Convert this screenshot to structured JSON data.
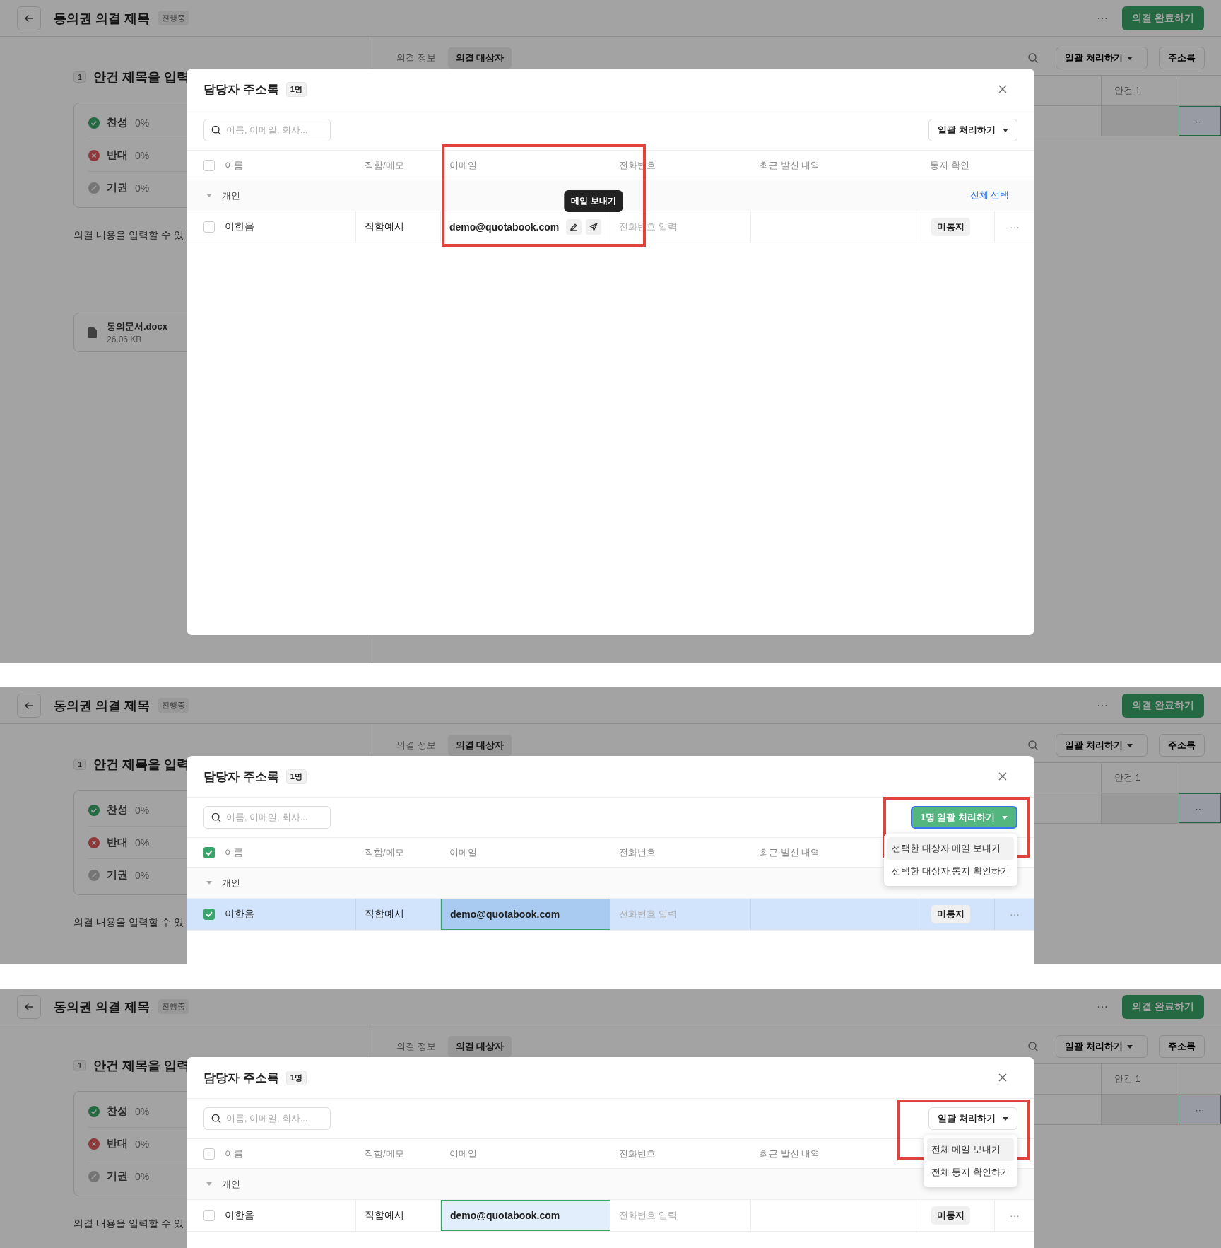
{
  "panels": [
    {
      "app": {
        "title": "동의권 의결 제목",
        "status_badge": "진행중",
        "more": "···",
        "complete_button": "의결 완료하기",
        "agenda": {
          "number": "1",
          "title": "안건 제목을 입력"
        },
        "votes": [
          {
            "kind": "for",
            "label": "찬성",
            "percent": "0%"
          },
          {
            "kind": "against",
            "label": "반대",
            "percent": "0%"
          },
          {
            "kind": "abstain",
            "label": "기권",
            "percent": "0%"
          }
        ],
        "description": "의결 내용을 입력할 수 있",
        "attachment": {
          "name": "동의문서.docx",
          "size": "26.06 KB"
        },
        "tabs": [
          {
            "label": "의결 정보",
            "selected": false
          },
          {
            "label": "의결 대상자",
            "selected": true
          }
        ],
        "batch_button": "일괄 처리하기",
        "address_book_button": "주소록",
        "sheet": {
          "column": "안건 1",
          "cell": "···"
        }
      },
      "modal": {
        "title": "담당자 주소록",
        "count": "1명",
        "search": {
          "placeholder": "이름, 이메일, 회사..."
        },
        "batch_button": {
          "label": "일괄 처리하기",
          "primary": false
        },
        "columns": [
          "이름",
          "직함/메모",
          "이메일",
          "전화번호",
          "최근 발신 내역",
          "통지 확인"
        ],
        "all_checked": false,
        "groups": [
          {
            "label": "개인",
            "expanded": true,
            "select_all": "전체 선택",
            "rows": [
              {
                "checked": false,
                "selected": false,
                "name": "이한음",
                "title": "직함예시",
                "email": "demo@quotabook.com",
                "email_hovered": true,
                "email_tooltip": "메일 보내기",
                "phone_placeholder": "전화번호 입력",
                "notice": "미통지",
                "more": "···"
              }
            ]
          }
        ]
      },
      "highlight_frame": true
    },
    {
      "app": {
        "title": "동의권 의결 제목",
        "status_badge": "진행중",
        "more": "···",
        "complete_button": "의결 완료하기",
        "agenda": {
          "number": "1",
          "title": "안건 제목을 입력"
        },
        "votes": [
          {
            "kind": "for",
            "label": "찬성",
            "percent": "0%"
          },
          {
            "kind": "against",
            "label": "반대",
            "percent": "0%"
          },
          {
            "kind": "abstain",
            "label": "기권",
            "percent": "0%"
          }
        ],
        "description": "의결 내용을 입력할 수 있",
        "tabs": [
          {
            "label": "의결 정보",
            "selected": false
          },
          {
            "label": "의결 대상자",
            "selected": true
          }
        ],
        "batch_button": "일괄 처리하기",
        "address_book_button": "주소록",
        "sheet": {
          "column": "안건 1",
          "cell": "···"
        }
      },
      "modal": {
        "title": "담당자 주소록",
        "count": "1명",
        "search": {
          "placeholder": "이름, 이메일, 회사..."
        },
        "batch_button": {
          "label": "1명 일괄 처리하기",
          "primary": true
        },
        "menu": [
          {
            "label": "선택한 대상자 메일 보내기",
            "highlighted": true
          },
          {
            "label": "선택한 대상자 통지 확인하기",
            "highlighted": false
          }
        ],
        "columns": [
          "이름",
          "직함/메모",
          "이메일",
          "전화번호",
          "최근 발신 내역"
        ],
        "all_checked": true,
        "groups": [
          {
            "label": "개인",
            "expanded": true,
            "rows": [
              {
                "checked": true,
                "selected": true,
                "name": "이한음",
                "title": "직함예시",
                "email": "demo@quotabook.com",
                "email_selected": true,
                "phone_placeholder": "전화번호 입력",
                "notice": "미통지",
                "more": "···"
              }
            ]
          }
        ]
      },
      "highlight_frame": true
    },
    {
      "app": {
        "title": "동의권 의결 제목",
        "status_badge": "진행중",
        "more": "···",
        "complete_button": "의결 완료하기",
        "agenda": {
          "number": "1",
          "title": "안건 제목을 입력"
        },
        "votes": [
          {
            "kind": "for",
            "label": "찬성",
            "percent": "0%"
          },
          {
            "kind": "against",
            "label": "반대",
            "percent": "0%"
          },
          {
            "kind": "abstain",
            "label": "기권",
            "percent": "0%"
          }
        ],
        "description": "의결 내용을 입력할 수 있",
        "tabs": [
          {
            "label": "의결 정보",
            "selected": false
          },
          {
            "label": "의결 대상자",
            "selected": true
          }
        ],
        "batch_button": "일괄 처리하기",
        "address_book_button": "주소록",
        "sheet": {
          "column": "안건 1",
          "cell": "···"
        }
      },
      "modal": {
        "title": "담당자 주소록",
        "count": "1명",
        "search": {
          "placeholder": "이름, 이메일, 회사..."
        },
        "batch_button": {
          "label": "일괄 처리하기",
          "primary": false
        },
        "menu": [
          {
            "label": "전체 메일 보내기",
            "highlighted": true
          },
          {
            "label": "전체 통지 확인하기",
            "highlighted": false
          }
        ],
        "columns": [
          "이름",
          "직함/메모",
          "이메일",
          "전화번호",
          "최근 발신 내역"
        ],
        "all_checked": false,
        "groups": [
          {
            "label": "개인",
            "expanded": true,
            "rows": [
              {
                "checked": false,
                "selected": false,
                "name": "이한음",
                "title": "직함예시",
                "email": "demo@quotabook.com",
                "email_focused": true,
                "phone_placeholder": "전화번호 입력",
                "notice": "미통지",
                "more": "···"
              }
            ]
          }
        ]
      },
      "highlight_frame": true
    }
  ]
}
